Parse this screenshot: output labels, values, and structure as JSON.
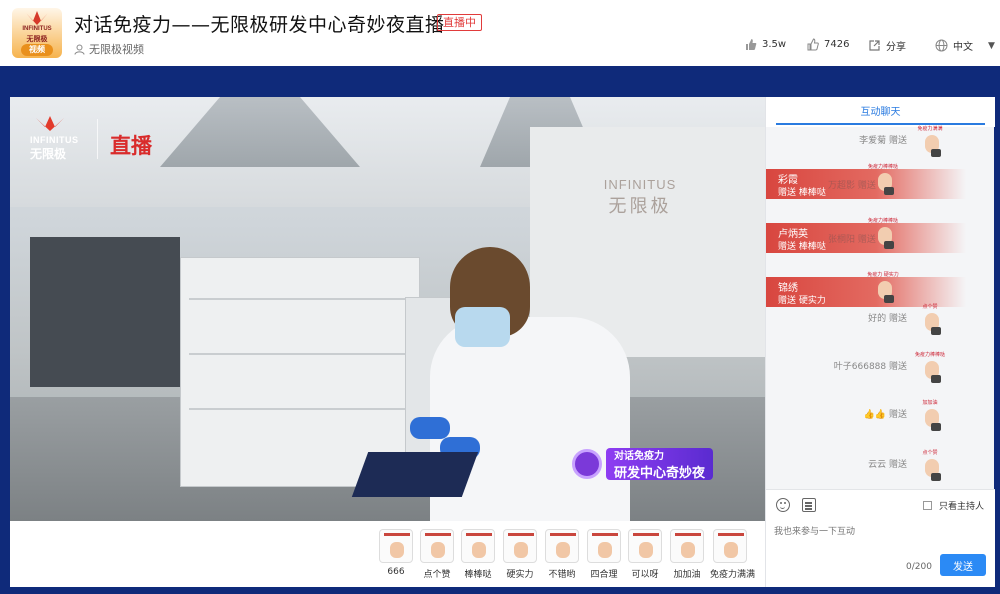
{
  "header": {
    "logo_brand": "INFINITUS",
    "logo_brand_cn": "无限极",
    "logo_tag": "视频",
    "title": "对话免疫力——无限极研发中心奇妙夜直播",
    "live_badge": "直播中",
    "channel": "无限极视频",
    "views": "3.5w",
    "likes": "7426",
    "share_label": "分享",
    "language": "中文",
    "icons": [
      "thumb-icon",
      "like-icon",
      "share-icon",
      "globe-icon",
      "user-icon"
    ]
  },
  "video": {
    "logo_en": "INFINITUS",
    "logo_cn": "无限极",
    "live_text": "直播",
    "watermark_en": "INFINITUS",
    "watermark_cn": "无限极",
    "promo_line1": "对话免疫力",
    "promo_line2": "研发中心奇妙夜"
  },
  "gifts": [
    {
      "label": "666"
    },
    {
      "label": "点个赞"
    },
    {
      "label": "棒棒哒"
    },
    {
      "label": "硬实力"
    },
    {
      "label": "不错哟"
    },
    {
      "label": "四合理"
    },
    {
      "label": "可以呀"
    },
    {
      "label": "加加油"
    },
    {
      "label": "免疫力满满"
    }
  ],
  "chat": {
    "tab_label": "互动聊天",
    "messages": [
      {
        "text": "李爱菊 赠送",
        "sticker": "免疫力满满"
      },
      {
        "text": "好的 赠送",
        "sticker": "点个赞"
      },
      {
        "text": "叶子666888 赠送",
        "sticker": "免疫力棒棒哒"
      },
      {
        "text": "👍👍 赠送",
        "sticker": "加加油"
      },
      {
        "text": "云云 赠送",
        "sticker": "点个赞"
      }
    ],
    "banners": [
      {
        "name": "彩霞",
        "gift": "赠送 棒棒哒",
        "ghost": "万超影 赠送",
        "sticker": "免疫力棒棒哒"
      },
      {
        "name": "卢炳英",
        "gift": "赠送 棒棒哒",
        "ghost": "张桐阳 赠送",
        "sticker": "免疫力棒棒哒"
      },
      {
        "name": "锦绣",
        "gift": "赠送 硬实力",
        "ghost": "",
        "sticker": "免疫力 硬实力"
      }
    ],
    "host_only_label": "只看主持人",
    "input_placeholder": "我也来参与一下互动",
    "char_count": "0/200",
    "send_label": "发送"
  },
  "colors": {
    "page_bg": "#0f2a7a",
    "accent_blue": "#2b8af5",
    "live_red": "#e13b3b",
    "banner_red": "#d8463f",
    "promo_purple": "#8e3df2"
  }
}
